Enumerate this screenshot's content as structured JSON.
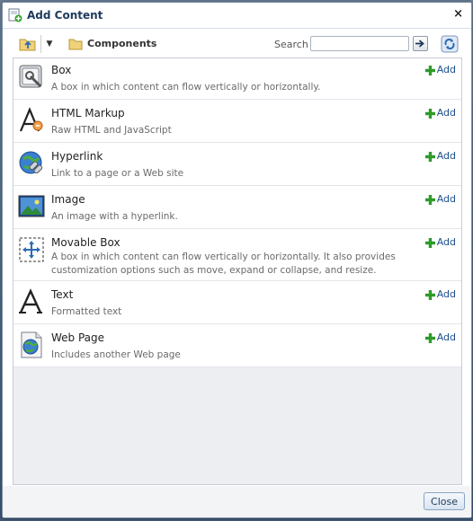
{
  "dialog": {
    "title": "Add Content",
    "close_glyph": "×"
  },
  "toolbar": {
    "breadcrumb": "Components",
    "search_label": "Search",
    "search_value": "",
    "dropdown_glyph": "▼"
  },
  "items": [
    {
      "title": "Box",
      "description": "A box in which content can flow vertically or horizontally.",
      "icon": "box-icon",
      "add_label": "Add"
    },
    {
      "title": "HTML Markup",
      "description": "Raw HTML and JavaScript",
      "icon": "html-markup-icon",
      "add_label": "Add"
    },
    {
      "title": "Hyperlink",
      "description": "Link to a page or a Web site",
      "icon": "hyperlink-icon",
      "add_label": "Add"
    },
    {
      "title": "Image",
      "description": "An image with a hyperlink.",
      "icon": "image-icon",
      "add_label": "Add"
    },
    {
      "title": "Movable Box",
      "description": "A box in which content can flow vertically or horizontally. It also provides customization options such as move, expand or collapse, and resize.",
      "icon": "movable-box-icon",
      "add_label": "Add"
    },
    {
      "title": "Text",
      "description": "Formatted text",
      "icon": "text-icon",
      "add_label": "Add"
    },
    {
      "title": "Web Page",
      "description": "Includes another Web page",
      "icon": "web-page-icon",
      "add_label": "Add"
    }
  ],
  "footer": {
    "close_label": "Close"
  },
  "colors": {
    "accent": "#1a4e8a",
    "add_plus": "#2f9a2a"
  }
}
